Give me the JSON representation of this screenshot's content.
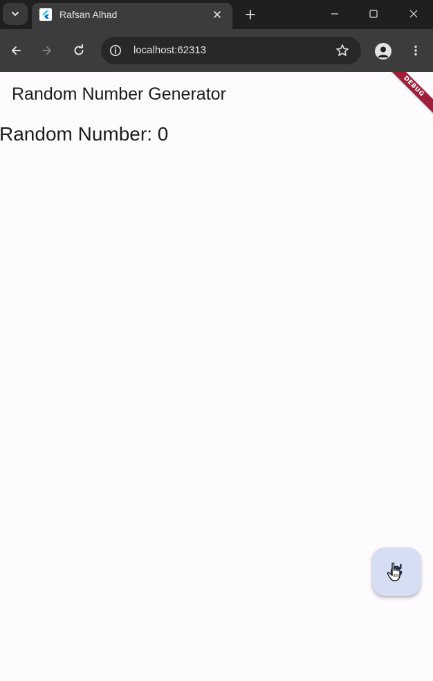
{
  "browser": {
    "tab_title": "Rafsan Alhad",
    "url": "localhost:62313"
  },
  "app": {
    "appbar_title": "Random Number Generator",
    "random_number_text": "Random Number: 0",
    "debug_banner": "DEBUG",
    "fab_icon": "refresh-icon"
  },
  "colors": {
    "chrome_dark": "#1f1f1f",
    "toolbar": "#3c3c3c",
    "app_background": "#fefbff",
    "fab_background": "#d5def2",
    "debug_banner": "#a01e3a"
  }
}
